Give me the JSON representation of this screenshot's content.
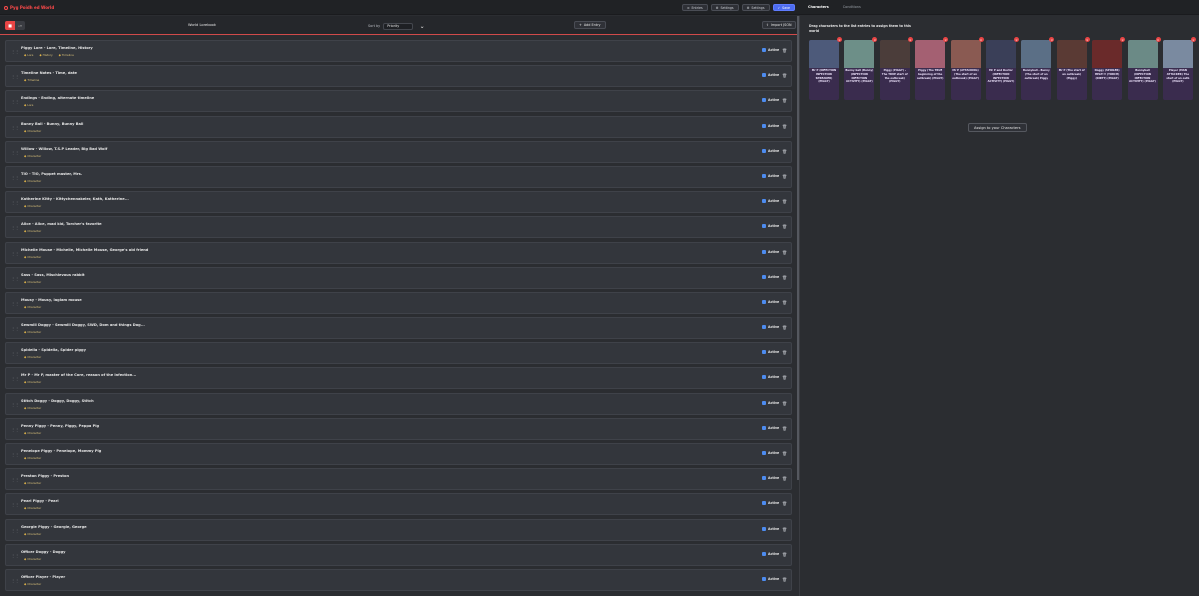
{
  "app": {
    "title": "Pyg Poidh ed World"
  },
  "topnav": [
    {
      "icon": "list-icon",
      "label": "Entries"
    },
    {
      "icon": "gear-icon",
      "label": "Settings"
    },
    {
      "icon": "gear-icon",
      "label": "Settings"
    },
    {
      "icon": "save-icon",
      "label": "Save"
    }
  ],
  "right_tabs": [
    "Characters",
    "Conditions"
  ],
  "toolbar": {
    "toggle_on": "■",
    "toggle_off": "off",
    "title": "World Lorebook",
    "sort_label": "Sort by",
    "sort_value": "Priority",
    "add_label": "Add Entry",
    "import_label": "Import JSON"
  },
  "entries": [
    {
      "name": "Piggy Lore - Lore, Timeline, History",
      "tags": [
        "Lore",
        "History",
        "Timeline"
      ]
    },
    {
      "name": "Timeline Notes - Time, date",
      "tags": [
        "Timeline"
      ]
    },
    {
      "name": "Endings - Ending, alternate timeline",
      "tags": [
        "Lore"
      ]
    },
    {
      "name": "Bunny Ball - Bunny, Bunny Ball",
      "tags": [
        "Character"
      ]
    },
    {
      "name": "Willow - Willow, T.S.P Leader, Big Bad Wolf",
      "tags": [
        "Character"
      ]
    },
    {
      "name": "TIO - TIO, Puppet master, Mrs.",
      "tags": [
        "Character"
      ]
    },
    {
      "name": "Katherine Kitty - Kittychennakeler, Kath, Katherine...",
      "tags": [
        "Character"
      ]
    },
    {
      "name": "Alice - Alice, mad kid, Torcher's favorite",
      "tags": [
        "Character"
      ]
    },
    {
      "name": "Michelle Mouse - Michelle, Michelle Mouse, George's old friend",
      "tags": [
        "Character"
      ]
    },
    {
      "name": "Sass - Sass, Mischievous rabbit",
      "tags": [
        "Character"
      ]
    },
    {
      "name": "Mousy - Mousy, laglam mouse",
      "tags": [
        "Character"
      ]
    },
    {
      "name": "Sewmill Doggy - Sewmill Doggy, SWD, Dom and things Dog...",
      "tags": [
        "Character"
      ]
    },
    {
      "name": "Spidella - Spidella, Spider piggy",
      "tags": [
        "Character"
      ]
    },
    {
      "name": "Mr P - Mr P, master of the Core, reason of the infection...",
      "tags": [
        "Character"
      ]
    },
    {
      "name": "Stitch Doggy - Doggy, Doggy, Stitch",
      "tags": [
        "Character"
      ]
    },
    {
      "name": "Penny Piggy - Penny, Piggy, Peppa Pig",
      "tags": [
        "Character"
      ]
    },
    {
      "name": "Penelope Piggy - Penelope, Mommy Pig",
      "tags": [
        "Character"
      ]
    },
    {
      "name": "Preston Piggy - Preston",
      "tags": [
        "Character"
      ]
    },
    {
      "name": "Pearl Piggy - Pearl",
      "tags": [
        "Character"
      ]
    },
    {
      "name": "Georgie Piggy - Georgie, George",
      "tags": [
        "Character"
      ]
    },
    {
      "name": "Officer Doggy - Doggy",
      "tags": [
        "Character"
      ]
    },
    {
      "name": "Officer Player - Player",
      "tags": [
        "Character"
      ]
    }
  ],
  "entry_active_label": "Active",
  "right": {
    "hint": "Drag characters to the list entries to assign them to this world",
    "cards": [
      {
        "caption": "Mr P (INFECTION INFECTION SPREADER) (PIGGY)",
        "color": "#4d5a7a"
      },
      {
        "caption": "Bunny ball (Bunny) (INFECTION INFECTION ACTIVITY) (PIGGY)",
        "color": "#6d8f88"
      },
      {
        "caption": "Piggy (PIGGY) - The TRUE start of the outbreak) (PIGGY)",
        "color": "#4b3d3a"
      },
      {
        "caption": "Piggy (The TRUE beginning of the outbreak) (PIGGY)",
        "color": "#a46072"
      },
      {
        "caption": "Mr P (ATTACKING) (The start of an outbreak) (PIGGY)",
        "color": "#8a5a52"
      },
      {
        "caption": "Mr P and Doctor (INFECTION INFECTION ACTIVITY) (PIGGY)",
        "color": "#3a3f58"
      },
      {
        "caption": "Bunnyball - Bunny (The start of an outbreak) Piggy",
        "color": "#5b6f86"
      },
      {
        "caption": "Mr P (The start of an outbreak) (Piggy)",
        "color": "#5a3a34"
      },
      {
        "caption": "Doggy (SPOILER) HELP!!! (TORCH) (DIRTY) (PIGGY)",
        "color": "#6a2a2a"
      },
      {
        "caption": "Bunnyball (INFECTION INFECTION ACTIVITY) (PIGGY)",
        "color": "#6b8a86"
      },
      {
        "caption": "Player (MAN ATTACKER) The start of an outb (PIGGY)",
        "color": "#7a8aa0"
      }
    ],
    "assign_label": "Assign to your Characters"
  },
  "colors": {
    "accent_red": "#e84545",
    "primary_blue": "#4d6cf0",
    "tag_gold": "#d9c17a"
  }
}
